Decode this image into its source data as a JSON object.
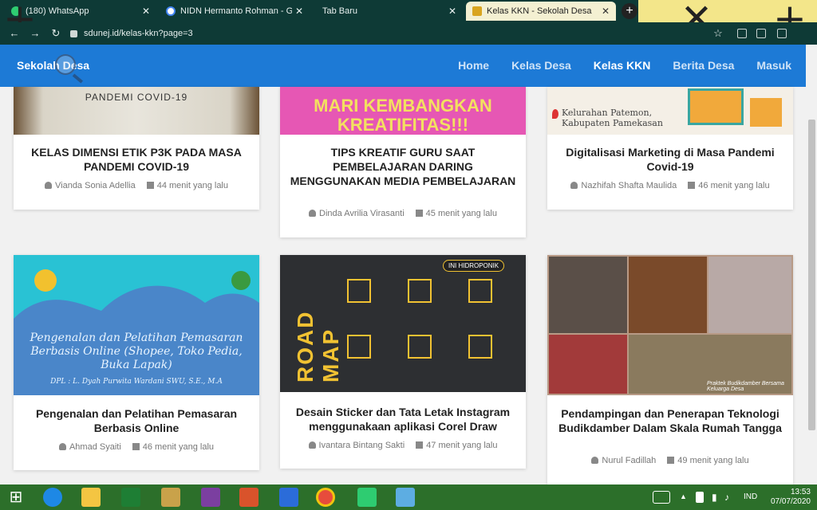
{
  "browser": {
    "tabs": [
      {
        "label": "(180) WhatsApp",
        "active": false
      },
      {
        "label": "NIDN Hermanto Rohman - Goog",
        "active": false
      },
      {
        "label": "Tab Baru",
        "active": false
      },
      {
        "label": "Kelas KKN - Sekolah Desa",
        "active": true
      }
    ],
    "url": "sdunej.id/kelas-kkn?page=3"
  },
  "site": {
    "brand": "Sekolah Desa",
    "nav": [
      {
        "label": "Home",
        "active": false
      },
      {
        "label": "Kelas Desa",
        "active": false
      },
      {
        "label": "Kelas KKN",
        "active": true
      },
      {
        "label": "Berita Desa",
        "active": false
      },
      {
        "label": "Masuk",
        "active": false
      }
    ]
  },
  "cards": [
    {
      "title": "KELAS DIMENSI ETIK P3K PADA MASA PANDEMI COVID-19",
      "author": "Vianda Sonia Adellia",
      "time": "44 menit yang lalu",
      "img_text": "PANDEMI COVID-19"
    },
    {
      "title": "TIPS KREATIF GURU SAAT PEMBELAJARAN DARING MENGGUNAKAN MEDIA PEMBELAJARAN",
      "author": "Dinda Avrilia Virasanti",
      "time": "45 menit yang lalu",
      "img_text": "MARI KEMBANGKAN KREATIFITAS!!!"
    },
    {
      "title": "Digitalisasi Marketing di Masa Pandemi Covid-19",
      "author": "Nazhifah Shafta Maulida",
      "time": "46 menit yang lalu",
      "img_text": "Kelurahan Patemon, Kabupaten Pamekasan"
    },
    {
      "title": "Pengenalan dan Pelatihan Pemasaran Berbasis Online",
      "author": "Ahmad Syaiti",
      "time": "46 menit yang lalu",
      "img_text": "Pengenalan dan Pelatihan Pemasaran Berbasis Online (Shopee, Toko Pedia, Buka Lapak)",
      "img_sub": "DPL : L. Dyah Purwita Wardani SWU, S.E., M.A"
    },
    {
      "title": "Desain Sticker dan Tata Letak Instagram menggunakaan aplikasi Corel Draw",
      "author": "Ivantara Bintang Sakti",
      "time": "47 menit yang lalu",
      "img_text": "ROAD MAP",
      "img_badge": "INI HIDROPONIK"
    },
    {
      "title": "Pendampingan dan Penerapan Teknologi Budikdamber Dalam Skala Rumah Tangga",
      "author": "Nurul Fadillah",
      "time": "49 menit yang lalu",
      "img_text": "Praktek Budikdamber Bersama Keluarga Desa"
    }
  ],
  "taskbar": {
    "lang": "IND",
    "time": "13:53",
    "date": "07/07/2020"
  },
  "colors": {
    "header": "#1d7ad6",
    "browser_chrome": "#0e3a36",
    "taskbar": "#2c6f2a"
  }
}
